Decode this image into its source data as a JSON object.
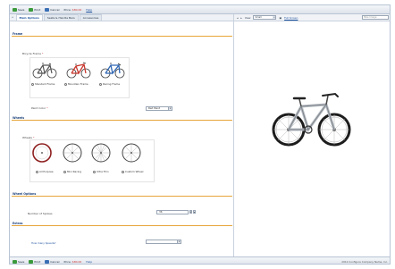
{
  "toolbar": {
    "save_label": "Save",
    "print_label": "Print",
    "cancel_label": "Cancel",
    "status_label": "Price:",
    "status_value": "$80.00",
    "help_label": "Help"
  },
  "tabs": [
    {
      "label": "Main Options",
      "active": true
    },
    {
      "label": "Seats & Handle Bars",
      "active": false
    },
    {
      "label": "Accessories",
      "active": false
    }
  ],
  "sections": {
    "frame": "Frame",
    "wheels": "Wheels",
    "wheel_options": "Wheel Options",
    "extras": "Extras"
  },
  "frame": {
    "label": "Bicycle Frame",
    "options": [
      "Standard Frame",
      "Mountain Frame",
      "Racing Frame"
    ],
    "paint_label": "Paint Color",
    "paint_value": "Red Paint"
  },
  "wheels": {
    "label": "Wheels",
    "options": [
      "All Purpose",
      "Mini Racing",
      "Ultra Thin",
      "Custom Wheel"
    ]
  },
  "wheel_options": {
    "spokes_label": "Number of Spokes",
    "spokes_value": "36"
  },
  "extras": {
    "speed_label": "How many Speeds?",
    "speed_value": ""
  },
  "viewer": {
    "view_label": "View",
    "view_value": "Small",
    "fullscreen_label": "Full Screen",
    "search_placeholder": "Bike Image"
  },
  "footer": {
    "copyright": "2012 Configure Company Name, Inc."
  },
  "colors": {
    "accent": "#e7a53a",
    "section_text": "#1a3f7a",
    "frame_red": "#c8382f",
    "frame_blue": "#2f66b3"
  }
}
